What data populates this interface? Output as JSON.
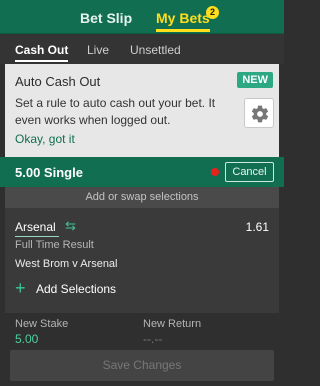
{
  "tabs": {
    "bet_slip": "Bet Slip",
    "my_bets": "My Bets",
    "my_bets_count": "2"
  },
  "subnav": {
    "cash_out": "Cash Out",
    "live": "Live",
    "unsettled": "Unsettled"
  },
  "promo": {
    "title": "Auto Cash Out",
    "badge": "NEW",
    "body": "Set a rule to auto cash out your bet. It even works when logged out.",
    "link": "Okay, got it"
  },
  "bet": {
    "summary": "5.00 Single",
    "cancel": "Cancel",
    "swap_banner": "Add or swap selections",
    "selection_name": "Arsenal",
    "odds": "1.61",
    "market": "Full Time Result",
    "event": "West Brom v Arsenal",
    "add_selections": "Add Selections"
  },
  "stake": {
    "new_stake_label": "New Stake",
    "new_stake_value": "5.00",
    "new_return_label": "New Return",
    "new_return_value": "--.--",
    "save_button": "Save Changes"
  },
  "colors": {
    "brand_green": "#126e51",
    "accent_yellow": "#ffdf1b",
    "accent_mint": "#3cc79a",
    "live_red": "#e8211c"
  }
}
